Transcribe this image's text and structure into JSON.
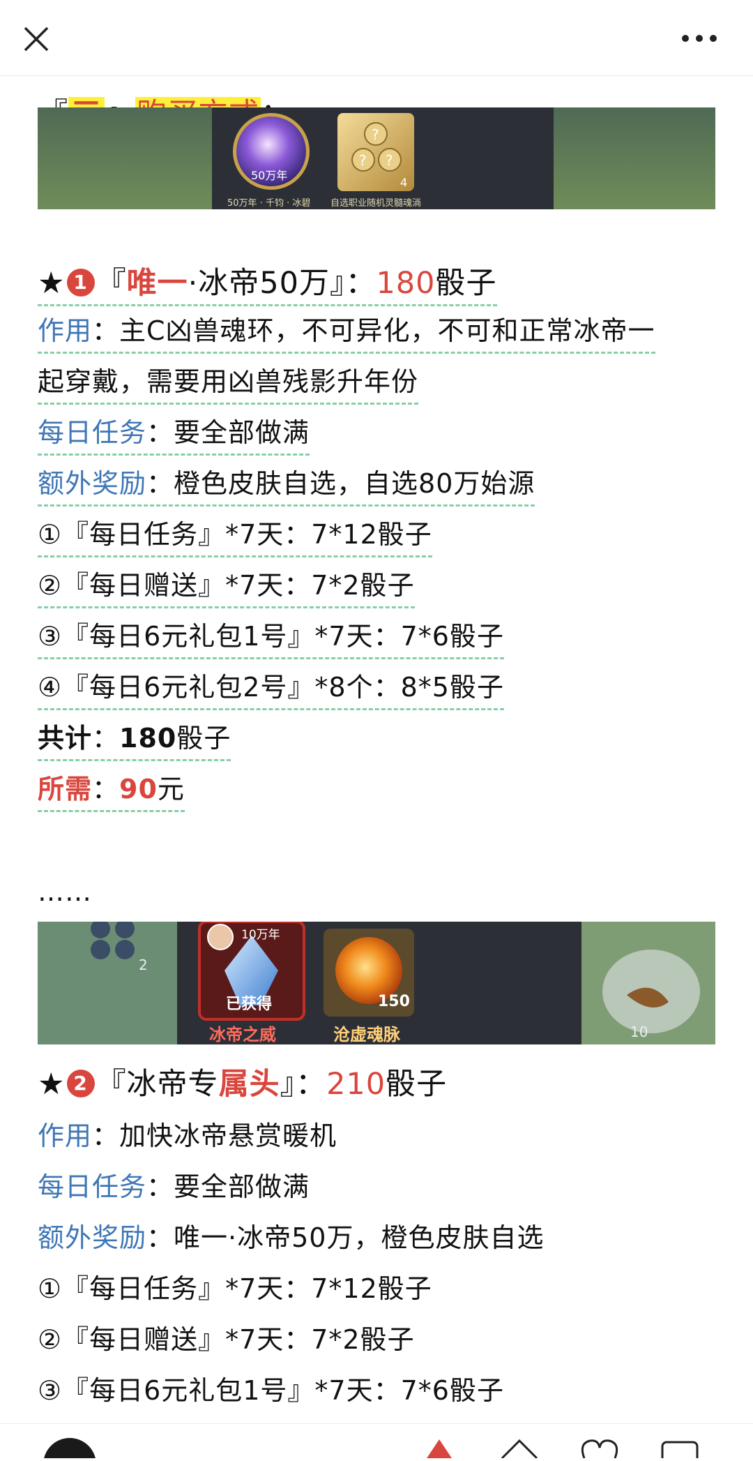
{
  "section": {
    "prefix_open": "『",
    "number": "三",
    "prefix_close": "』",
    "title": "购买方式",
    "colon": "："
  },
  "banner1": {
    "item1_badge": "50万年",
    "item1_caption": "50万年 · 千钧 · 冰碧",
    "item2_count": "4",
    "item2_caption": "自选职业随机灵髓魂淌"
  },
  "pack1": {
    "star": "★",
    "num": "1",
    "open": "『",
    "title_highlight": "唯一",
    "title_rest": "·冰帝50万",
    "close": "』：",
    "price_num": "180",
    "price_unit": "骰子",
    "effect_label": "作用",
    "effect_line1": "：主C凶兽魂环，不可异化，不可和正常冰帝一",
    "effect_line2": "起穿戴，需要用凶兽残影升年份",
    "daily_label": "每日任务",
    "daily_text": "：要全部做满",
    "bonus_label": "额外奖励",
    "bonus_text": "：橙色皮肤自选，自选80万始源",
    "items": [
      "①『每日任务』*7天：7*12骰子",
      "②『每日赠送』*7天：7*2骰子",
      "③『每日6元礼包1号』*7天：7*6骰子",
      "④『每日6元礼包2号』*8个：8*5骰子"
    ],
    "total_label": "共计",
    "total_colon": "：",
    "total_num": "180",
    "total_unit": "骰子",
    "need_label": "所需",
    "need_colon": "：",
    "need_num": "90",
    "need_unit": "元"
  },
  "ellipsis": "……",
  "banner2": {
    "left_count": "2",
    "item1_year": "10万年",
    "item1_status": "已获得",
    "item1_name": "冰帝之威",
    "item2_count": "150",
    "item2_name": "沧虚魂脉",
    "right_count": "10"
  },
  "pack2": {
    "star": "★",
    "num": "2",
    "open": "『冰帝专",
    "title_highlight": "属头",
    "close": "』：",
    "price_num": "210",
    "price_unit": "骰子",
    "effect_label": "作用",
    "effect_text": "：加快冰帝悬赏暖机",
    "daily_label": "每日任务",
    "daily_text": "：要全部做满",
    "bonus_label": "额外奖励",
    "bonus_text": "：唯一·冰帝50万，橙色皮肤自选",
    "items": [
      "①『每日任务』*7天：7*12骰子",
      "②『每日赠送』*7天：7*2骰子",
      "③『每日6元礼包1号』*7天：7*6骰子"
    ]
  },
  "colors": {
    "accent_red": "#d9463d",
    "label_blue": "#3e76b6",
    "highlight_yellow": "#ffef3a",
    "underline_green": "#86cfa5"
  }
}
